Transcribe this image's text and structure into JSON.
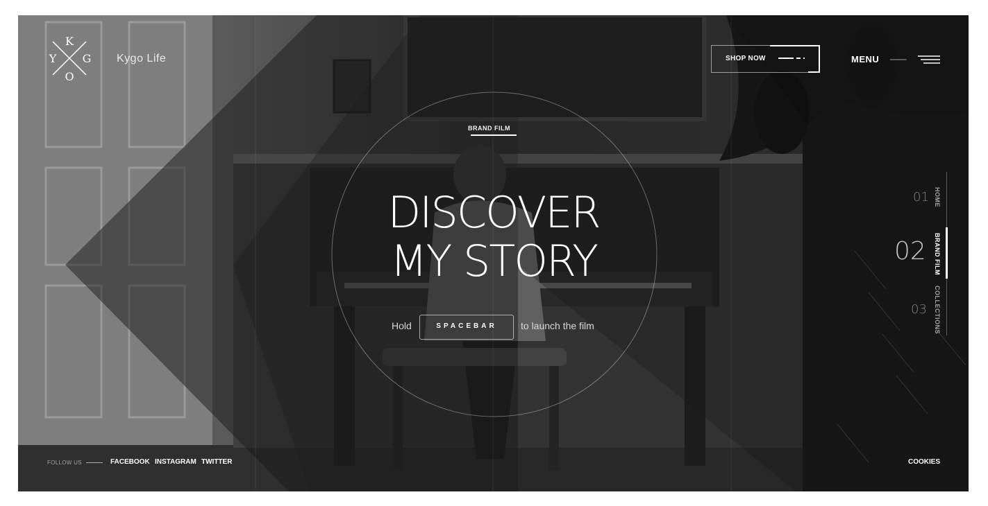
{
  "brand": {
    "logo_letters": {
      "top": "K",
      "left": "Y",
      "right": "G",
      "bottom": "O"
    },
    "name": "Kygo Life"
  },
  "header": {
    "shop_now": "SHOP NOW",
    "menu": "MENU"
  },
  "hero": {
    "kicker": "BRAND FILM",
    "headline_line1": "DISCOVER",
    "headline_line2": "MY STORY",
    "hold": "Hold",
    "spacebar": "SPACEBAR",
    "launch": "to launch the film"
  },
  "side_nav": [
    {
      "number": "01",
      "label": "HOME",
      "active": false
    },
    {
      "number": "02",
      "label": "BRAND FILM",
      "active": true
    },
    {
      "number": "03",
      "label": "COLLECTIONS",
      "active": false
    }
  ],
  "footer": {
    "follow_us": "FOLLOW US",
    "social": [
      "FACEBOOK",
      "INSTAGRAM",
      "TWITTER"
    ],
    "cookies": "COOKIES"
  },
  "colors": {
    "accent": "#ffffff",
    "background": "#3d3d3d",
    "overlay": "#1f1f1f"
  },
  "icons": [
    "logo-x-icon",
    "hamburger-menu-icon",
    "shop-arrow-icon"
  ]
}
